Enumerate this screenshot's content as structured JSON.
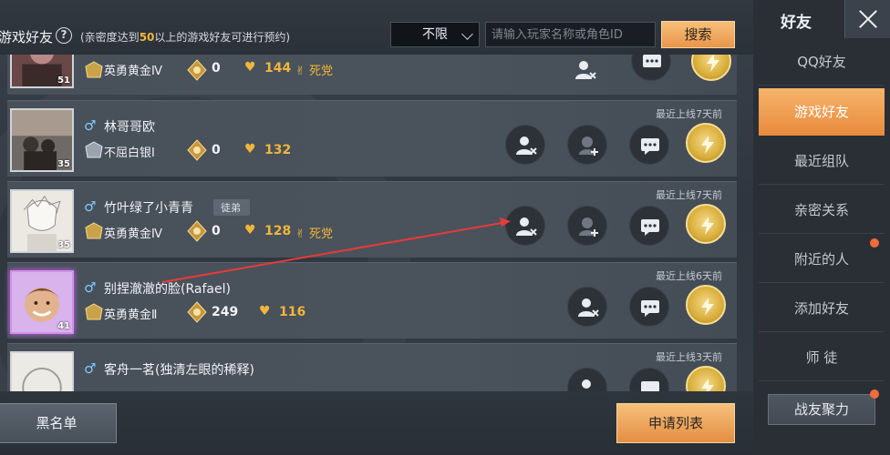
{
  "header": {
    "title": "游戏好友",
    "hint_pre": "(亲密度达到",
    "hint_num": "50",
    "hint_post": "以上的游戏好友可进行预约)",
    "filter_value": "不限",
    "search_placeholder": "请输入玩家名称或角色ID",
    "search_label": "搜索"
  },
  "friends": [
    {
      "name": "",
      "rank": "英勇黄金Ⅳ",
      "score": "0",
      "intimacy": "144",
      "relation": "死党",
      "avatar_level": "51",
      "online": ""
    },
    {
      "name": "林哥哥欧",
      "rank": "不屈白银Ⅰ",
      "score": "0",
      "intimacy": "132",
      "relation": "",
      "avatar_level": "35",
      "online": "最近上线7天前"
    },
    {
      "name": "竹叶绿了小青青",
      "tag": "徒弟",
      "rank": "英勇黄金Ⅳ",
      "score": "0",
      "intimacy": "128",
      "relation": "死党",
      "avatar_level": "35",
      "online": "最近上线7天前"
    },
    {
      "name": "别捏澈澈的脸(Rafael)",
      "rank": "英勇黄金Ⅱ",
      "score": "249",
      "intimacy": "116",
      "relation": "",
      "avatar_level": "41",
      "online": "最近上线6天前"
    },
    {
      "name": "客舟一茗(独清左眼的稀释)",
      "rank": "",
      "score": "",
      "intimacy": "",
      "relation": "",
      "avatar_level": "",
      "online": "最近上线3天前"
    }
  ],
  "bottom": {
    "blacklist_label": "黑名单",
    "apply_label": "申请列表"
  },
  "sidebar": {
    "title": "好友",
    "items": [
      {
        "label": "QQ好友"
      },
      {
        "label": "游戏好友"
      },
      {
        "label": "最近组队"
      },
      {
        "label": "亲密关系"
      },
      {
        "label": "附近的人"
      },
      {
        "label": "添加好友"
      },
      {
        "label": "师  徒"
      }
    ],
    "bottom_button": "战友聚力"
  },
  "colors": {
    "accent": "#f0b63a",
    "active_tab": "#e88a3c",
    "male": "#7ec8ff",
    "notification": "#f06c3a",
    "annotation_arrow": "#e83a3a"
  }
}
